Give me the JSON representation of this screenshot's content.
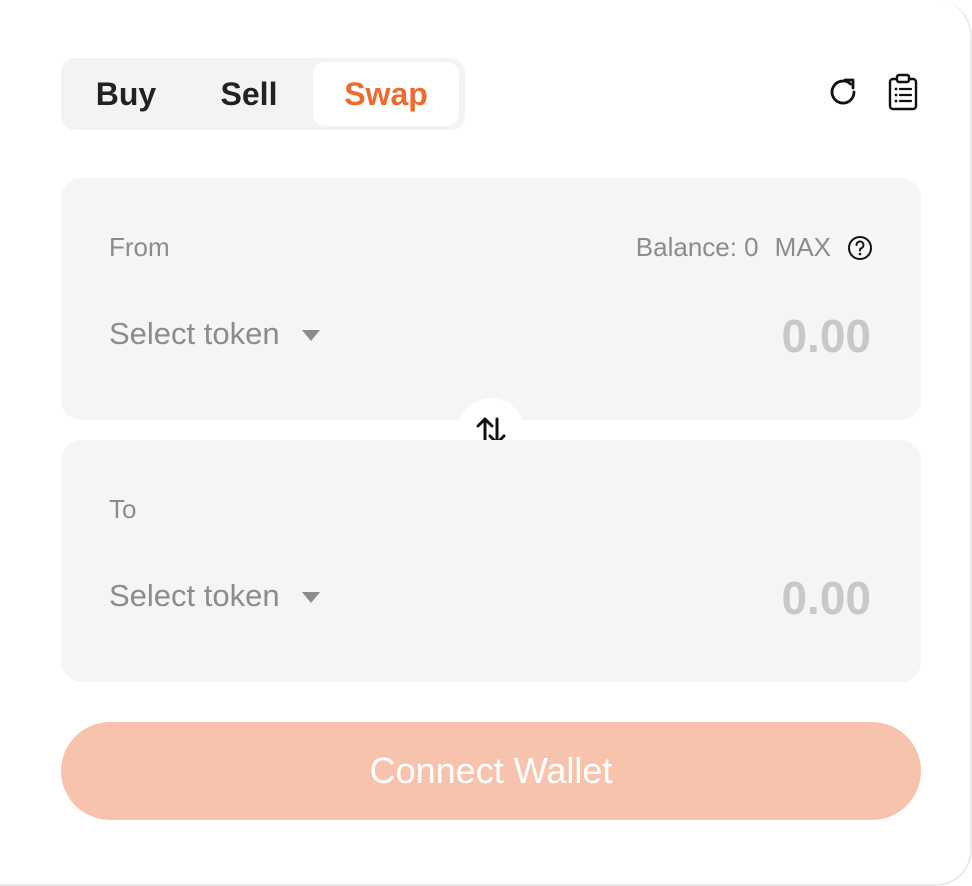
{
  "tabs": [
    {
      "label": "Buy",
      "active": false
    },
    {
      "label": "Sell",
      "active": false
    },
    {
      "label": "Swap",
      "active": true
    }
  ],
  "header_icons": [
    "refresh-icon",
    "clipboard-icon"
  ],
  "from": {
    "label": "From",
    "balance_label": "Balance: 0",
    "max_label": "MAX",
    "token_select": "Select token",
    "amount_placeholder": "0.00"
  },
  "to": {
    "label": "To",
    "token_select": "Select token",
    "amount_placeholder": "0.00"
  },
  "connect_button": "Connect Wallet",
  "colors": {
    "accent": "#ef6a2e",
    "button_bg": "#f7c3ad",
    "panel_bg": "#f5f5f5"
  }
}
